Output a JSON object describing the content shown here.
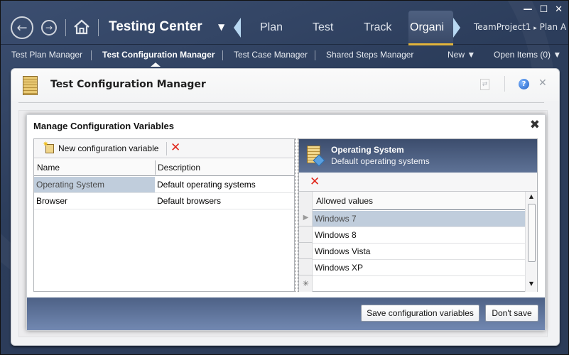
{
  "app": {
    "title": "Testing Center",
    "title_dropdown_icon": "▼",
    "back_icon": "arrow-left-circle",
    "forward_icon": "arrow-right-circle",
    "home_icon": "house",
    "main_tabs": [
      {
        "label": "Plan",
        "active": false
      },
      {
        "label": "Test",
        "active": false
      },
      {
        "label": "Track",
        "active": false
      },
      {
        "label": "Organi",
        "active": true
      }
    ],
    "breadcrumb": {
      "project": "TeamProject1",
      "separator": "▸",
      "plan": "Plan A"
    },
    "window_controls": {
      "minimize": "—",
      "maximize": "☐",
      "close": "✕"
    }
  },
  "subnav": {
    "items": [
      {
        "label": "Test Plan Manager",
        "active": false
      },
      {
        "label": "Test Configuration Manager",
        "active": true
      },
      {
        "label": "Test Case Manager",
        "active": false
      },
      {
        "label": "Shared Steps Manager",
        "active": false
      }
    ],
    "new_label": "New ▼",
    "open_items_label": "Open Items (0) ▼"
  },
  "panel": {
    "title": "Test Configuration Manager",
    "refresh_icon": "⇄",
    "help_icon": "?",
    "close_icon": "✕"
  },
  "dialog": {
    "title": "Manage Configuration Variables",
    "close_icon": "✖",
    "left": {
      "new_button_label": "New configuration variable",
      "delete_icon": "✕",
      "columns": [
        "Name",
        "Description"
      ],
      "rows": [
        {
          "name": "Operating System",
          "description": "Default operating systems",
          "selected": true
        },
        {
          "name": "Browser",
          "description": "Default browsers",
          "selected": false
        }
      ]
    },
    "right": {
      "variable_name": "Operating System",
      "variable_description": "Default operating systems",
      "delete_icon": "✕",
      "column": "Allowed values",
      "values": [
        {
          "value": "Windows 7",
          "selected": true
        },
        {
          "value": "Windows 8",
          "selected": false
        },
        {
          "value": "Windows Vista",
          "selected": false
        },
        {
          "value": "Windows XP",
          "selected": false
        }
      ],
      "new_row_marker": "✳",
      "current_row_marker": "▶"
    },
    "buttons": {
      "save": "Save configuration variables",
      "dont_save": "Don't save"
    }
  }
}
